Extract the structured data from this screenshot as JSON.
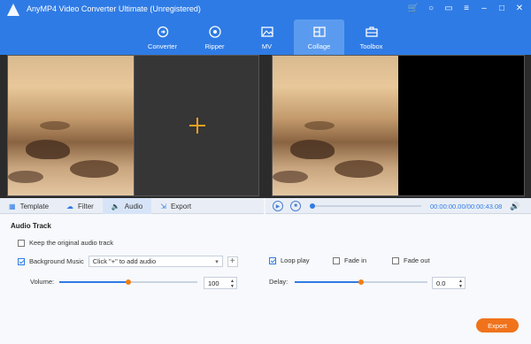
{
  "app": {
    "title": "AnyMP4 Video Converter Ultimate (Unregistered)"
  },
  "nav": {
    "tabs": [
      {
        "label": "Converter"
      },
      {
        "label": "Ripper"
      },
      {
        "label": "MV"
      },
      {
        "label": "Collage"
      },
      {
        "label": "Toolbox"
      }
    ],
    "active": "Collage"
  },
  "subtabs": {
    "template": "Template",
    "filter": "Filter",
    "audio": "Audio",
    "export": "Export"
  },
  "player": {
    "time": "00:00:00.00/00:00:43.08",
    "progress": 0.0
  },
  "audio": {
    "section_title": "Audio Track",
    "keep_original_label": "Keep the original audio track",
    "keep_original_checked": false,
    "bg_music_label": "Background Music",
    "bg_music_checked": true,
    "music_select_value": "Click \"+\" to add audio",
    "add_icon": "+",
    "loop_play_label": "Loop play",
    "loop_play_checked": true,
    "fade_in_label": "Fade in",
    "fade_in_checked": false,
    "fade_out_label": "Fade out",
    "fade_out_checked": false,
    "volume_label": "Volume:",
    "volume_value": "100",
    "volume_level": 0.5,
    "delay_label": "Delay:",
    "delay_value": "0.0",
    "delay_level": 0.5
  },
  "export_button": "Export",
  "colors": {
    "accent": "#2f7be5",
    "export": "#f0731c",
    "knob": "#f07f16"
  }
}
